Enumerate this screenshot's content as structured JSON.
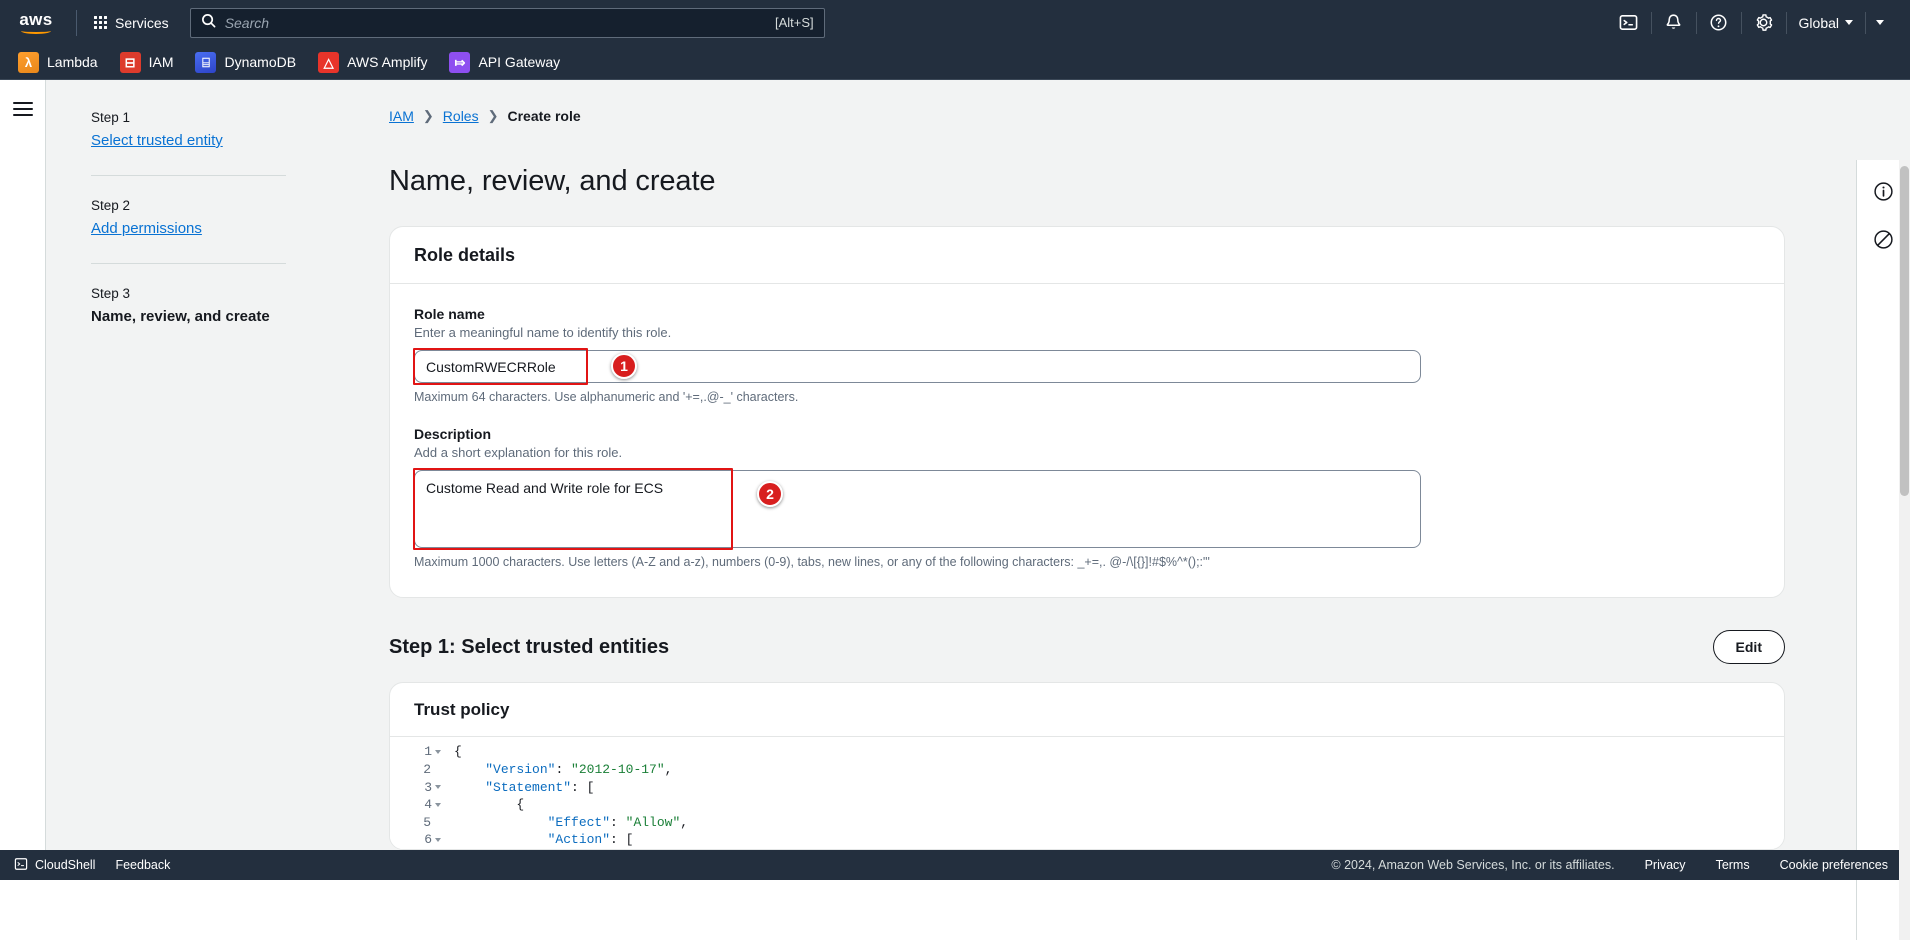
{
  "topnav": {
    "logo_word": "aws",
    "services_label": "Services",
    "search_placeholder": "Search",
    "search_hint": "[Alt+S]",
    "icons": [
      {
        "name": "cloudshell-icon",
        "glyph": ">_"
      },
      {
        "name": "notifications-icon",
        "glyph": "bell"
      },
      {
        "name": "help-icon",
        "glyph": "?"
      },
      {
        "name": "settings-icon",
        "glyph": "gear"
      }
    ],
    "region_label": "Global",
    "account_label": ""
  },
  "favorites": [
    {
      "label": "Lambda",
      "icon": "lambda-icon",
      "glyph": "λ"
    },
    {
      "label": "IAM",
      "icon": "iam-icon",
      "glyph": "⊟"
    },
    {
      "label": "DynamoDB",
      "icon": "dynamodb-icon",
      "glyph": "⌸"
    },
    {
      "label": "AWS Amplify",
      "icon": "amplify-icon",
      "glyph": "△"
    },
    {
      "label": "API Gateway",
      "icon": "apigateway-icon",
      "glyph": "⤇"
    }
  ],
  "breadcrumb": {
    "item1": "IAM",
    "item2": "Roles",
    "current": "Create role",
    "chevron": "❯"
  },
  "wizard": {
    "step1_kicker": "Step 1",
    "step1_label": "Select trusted entity",
    "step2_kicker": "Step 2",
    "step2_label": "Add permissions",
    "step3_kicker": "Step 3",
    "step3_label": "Name, review, and create"
  },
  "page": {
    "title": "Name, review, and create"
  },
  "role_details": {
    "panel_title": "Role details",
    "role_name_label": "Role name",
    "role_name_desc": "Enter a meaningful name to identify this role.",
    "role_name_value": "CustomRWECRRole",
    "role_name_hint": "Maximum 64 characters. Use alphanumeric and '+=,.@-_' characters.",
    "description_label": "Description",
    "description_desc": "Add a short explanation for this role.",
    "description_value": "Custome Read and Write role for ECS",
    "description_hint": "Maximum 1000 characters. Use letters (A-Z and a-z), numbers (0-9), tabs, new lines, or any of the following characters: _+=,. @-/\\[{}]!#$%^*();:\"'"
  },
  "annotations": [
    {
      "number": "1",
      "target": "role-name-input"
    },
    {
      "number": "2",
      "target": "description-textarea"
    }
  ],
  "step1_section": {
    "heading": "Step 1: Select trusted entities",
    "edit_label": "Edit"
  },
  "trust_policy": {
    "panel_title": "Trust policy",
    "lines": [
      {
        "num": "1",
        "fold": true,
        "segments": [
          {
            "t": "{",
            "c": "pun"
          }
        ]
      },
      {
        "num": "2",
        "fold": false,
        "segments": [
          {
            "t": "    ",
            "c": "pun"
          },
          {
            "t": "\"Version\"",
            "c": "key"
          },
          {
            "t": ": ",
            "c": "pun"
          },
          {
            "t": "\"2012-10-17\"",
            "c": "str"
          },
          {
            "t": ",",
            "c": "pun"
          }
        ]
      },
      {
        "num": "3",
        "fold": true,
        "segments": [
          {
            "t": "    ",
            "c": "pun"
          },
          {
            "t": "\"Statement\"",
            "c": "key"
          },
          {
            "t": ": [",
            "c": "pun"
          }
        ]
      },
      {
        "num": "4",
        "fold": true,
        "segments": [
          {
            "t": "        {",
            "c": "pun"
          }
        ]
      },
      {
        "num": "5",
        "fold": false,
        "segments": [
          {
            "t": "            ",
            "c": "pun"
          },
          {
            "t": "\"Effect\"",
            "c": "key"
          },
          {
            "t": ": ",
            "c": "pun"
          },
          {
            "t": "\"Allow\"",
            "c": "str"
          },
          {
            "t": ",",
            "c": "pun"
          }
        ]
      },
      {
        "num": "6",
        "fold": true,
        "segments": [
          {
            "t": "            ",
            "c": "pun"
          },
          {
            "t": "\"Action\"",
            "c": "key"
          },
          {
            "t": ": [",
            "c": "pun"
          }
        ]
      }
    ]
  },
  "help_rail": {
    "info_icon": "info-icon",
    "shortcut_icon": "no-entry-icon"
  },
  "footer": {
    "cloudshell_label": "CloudShell",
    "feedback_label": "Feedback",
    "copyright": "© 2024, Amazon Web Services, Inc. or its affiliates.",
    "privacy": "Privacy",
    "terms": "Terms",
    "cookies": "Cookie preferences"
  },
  "colors": {
    "nav_bg": "#232f3e",
    "link": "#0972d3",
    "annotation_red": "#e11414",
    "page_bg": "#f2f3f3"
  }
}
